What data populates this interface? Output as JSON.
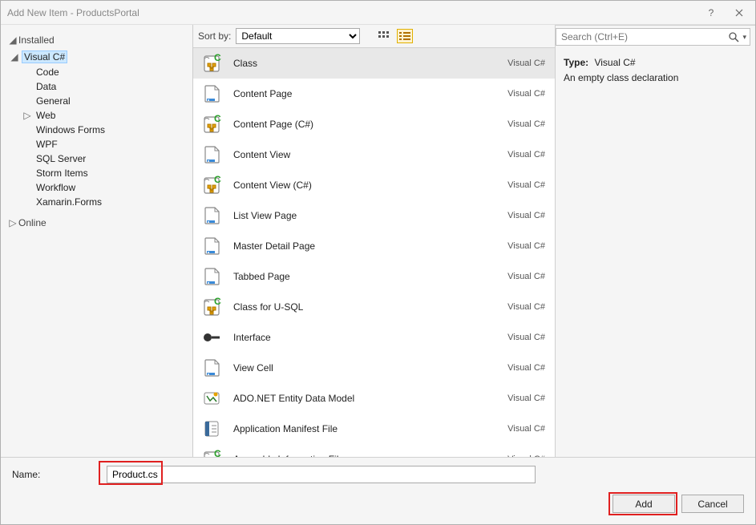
{
  "window_title": "Add New Item - ProductsPortal",
  "sidebar": {
    "installed_hdr": "Installed",
    "online_hdr": "Online",
    "csharp_node": "Visual C#",
    "items": [
      {
        "label": "Code"
      },
      {
        "label": "Data"
      },
      {
        "label": "General"
      },
      {
        "label": "Web",
        "expandable": true
      },
      {
        "label": "Windows Forms"
      },
      {
        "label": "WPF"
      },
      {
        "label": "SQL Server"
      },
      {
        "label": "Storm Items"
      },
      {
        "label": "Workflow"
      },
      {
        "label": "Xamarin.Forms"
      }
    ]
  },
  "toolbar": {
    "sort_label": "Sort by:",
    "sort_value": "Default"
  },
  "templates": [
    {
      "name": "Class",
      "lang": "Visual C#",
      "icon": "cs-class",
      "sel": true
    },
    {
      "name": "Content Page",
      "lang": "Visual C#",
      "icon": "page"
    },
    {
      "name": "Content Page (C#)",
      "lang": "Visual C#",
      "icon": "cs-class"
    },
    {
      "name": "Content View",
      "lang": "Visual C#",
      "icon": "page"
    },
    {
      "name": "Content View (C#)",
      "lang": "Visual C#",
      "icon": "cs-class"
    },
    {
      "name": "List View Page",
      "lang": "Visual C#",
      "icon": "page"
    },
    {
      "name": "Master Detail Page",
      "lang": "Visual C#",
      "icon": "page"
    },
    {
      "name": "Tabbed Page",
      "lang": "Visual C#",
      "icon": "page"
    },
    {
      "name": "Class for U-SQL",
      "lang": "Visual C#",
      "icon": "cs-class"
    },
    {
      "name": "Interface",
      "lang": "Visual C#",
      "icon": "interface"
    },
    {
      "name": "View Cell",
      "lang": "Visual C#",
      "icon": "page"
    },
    {
      "name": "ADO.NET Entity Data Model",
      "lang": "Visual C#",
      "icon": "model"
    },
    {
      "name": "Application Manifest File",
      "lang": "Visual C#",
      "icon": "manifest"
    },
    {
      "name": "Assembly Information File",
      "lang": "Visual C#",
      "icon": "cs-class"
    }
  ],
  "search": {
    "placeholder": "Search (Ctrl+E)"
  },
  "details": {
    "type_lbl": "Type:",
    "type_val": "Visual C#",
    "desc": "An empty class declaration"
  },
  "footer": {
    "name_lbl": "Name:",
    "name_val": "Product.cs",
    "add_btn": "Add",
    "cancel_btn": "Cancel"
  }
}
